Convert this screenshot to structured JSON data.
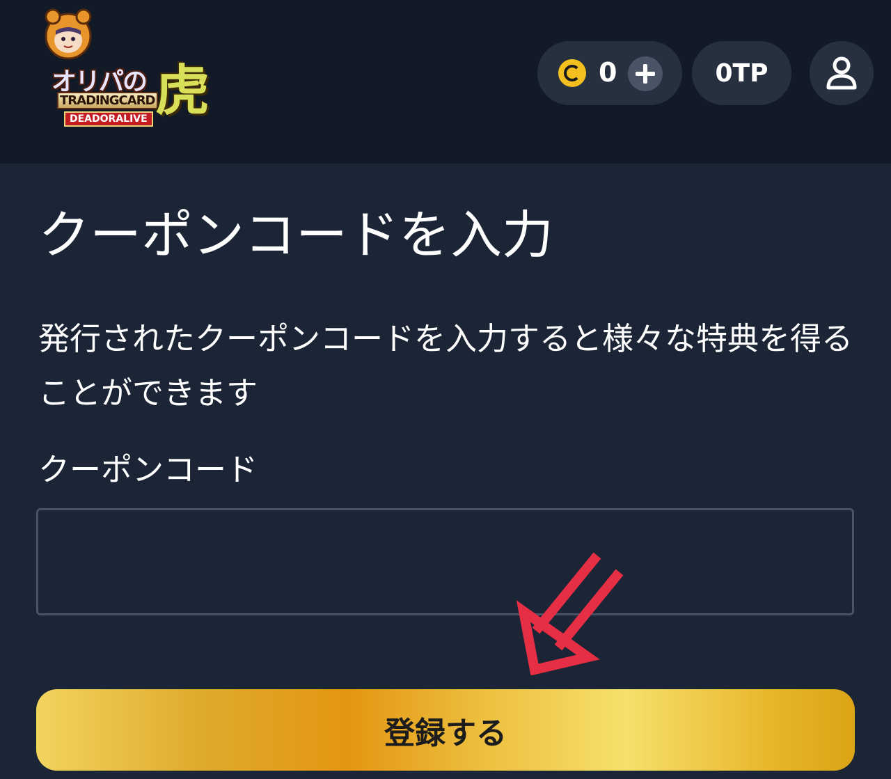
{
  "header": {
    "logo": {
      "line1": "オリパの",
      "line2": "TRADINGCARD",
      "line3": "DEADORALIVE",
      "kanji": "虎"
    },
    "coin_balance": "0",
    "tp_balance": "0TP"
  },
  "main": {
    "title": "クーポンコードを入力",
    "description": "発行されたクーポンコードを入力すると様々な特典を得ることができます",
    "field_label": "クーポンコード",
    "input_value": "",
    "submit_label": "登録する"
  },
  "icons": {
    "coin": "coin-icon",
    "plus": "plus-icon",
    "user": "user-icon",
    "arrow": "red-arrow-icon"
  },
  "colors": {
    "header_bg": "#121a28",
    "page_bg": "#1c2536",
    "pill_bg": "#27303f",
    "coin": "#f4c020",
    "arrow": "#e62e45",
    "button_gold": "#e39612"
  }
}
